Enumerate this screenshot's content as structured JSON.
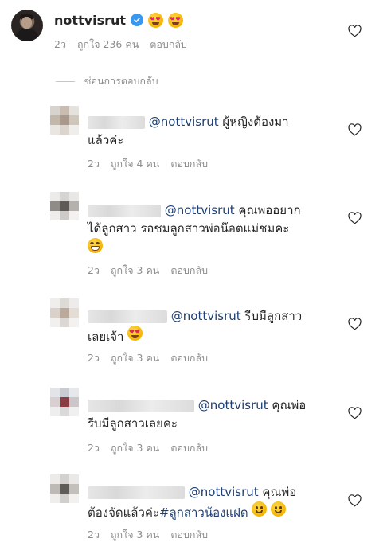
{
  "top_comment": {
    "username": "nottvisrut",
    "icons": [
      "verified-badge-icon",
      "heart-eyes-emoji",
      "heart-eyes-emoji"
    ],
    "time": "2ว",
    "likes": "ถูกใจ 236 คน",
    "reply": "ตอบกลับ"
  },
  "hide_replies": "ซ่อนการตอบกลับ",
  "replies": [
    {
      "mention": "@nottvisrut",
      "text1": " ผู้หญิงต้องมา",
      "text2": "แล้วค่ะ",
      "time": "2ว",
      "likes": "ถูกใจ 4 คน",
      "reply": "ตอบกลับ"
    },
    {
      "mention": "@nottvisrut",
      "text1": " คุณพ่ออยาก",
      "text2": "ได้ลูกสาว รอชมลูกสาวพ่อน๊อตแม่ชมคะ",
      "time": "2ว",
      "likes": "ถูกใจ 3 คน",
      "reply": "ตอบกลับ",
      "emoji": "grinning-emoji"
    },
    {
      "mention": "@nottvisrut",
      "text1": " รีบมีลูกสาว",
      "text2": "เลยเจ้า",
      "time": "2ว",
      "likes": "ถูกใจ 3 คน",
      "reply": "ตอบกลับ",
      "emoji": "heart-eyes-emoji"
    },
    {
      "mention": "@nottvisrut",
      "text1": " คุณพ่อ",
      "text2": "รีบมีลูกสาวเลยคะ",
      "time": "2ว",
      "likes": "ถูกใจ 3 คน",
      "reply": "ตอบกลับ"
    },
    {
      "mention": "@nottvisrut",
      "text1": " คุณพ่อ",
      "text2a": "ต้องจัดแล้วค่ะ",
      "hashtag": "#ลูกสาวน้องแฝด",
      "time": "2ว",
      "likes": "ถูกใจ 3 คน",
      "reply": "ตอบกลับ",
      "emoji": "smiling-emoji"
    }
  ],
  "colors": {
    "text": "#262626",
    "meta": "#8e8e8e",
    "mention": "#1d3f73",
    "verified": "#3897f0"
  }
}
